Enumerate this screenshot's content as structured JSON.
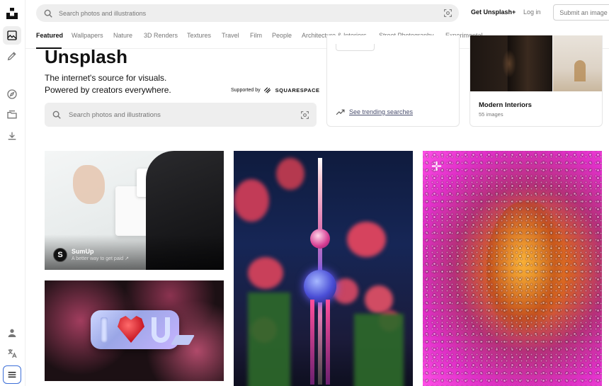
{
  "header": {
    "search_placeholder": "Search photos and illustrations",
    "get_plus": "Get Unsplash+",
    "login": "Log in",
    "submit": "Submit an image"
  },
  "tabs": [
    "Featured",
    "Wallpapers",
    "Nature",
    "3D Renders",
    "Textures",
    "Travel",
    "Film",
    "People",
    "Architecture & Interiors",
    "Street Photography",
    "Experimental"
  ],
  "active_tab": "Featured",
  "hero": {
    "title": "Unsplash",
    "subtitle_line1": "The internet's source for visuals.",
    "subtitle_line2": "Powered by creators everywhere.",
    "supported_by": "Supported by",
    "sponsor_brand": "SQUARESPACE",
    "search_placeholder": "Search photos and illustrations"
  },
  "trending": {
    "link": "See trending searches"
  },
  "collection": {
    "title": "Modern Interiors",
    "count": "55 images"
  },
  "sponsored_photo": {
    "name": "SumUp",
    "tagline": "A better way to get paid ↗"
  },
  "rail": [
    "unsplash-logo",
    "photos-icon",
    "illustrations-icon",
    "explore-icon",
    "collections-icon",
    "download-icon",
    "account-icon",
    "language-icon",
    "menu-icon"
  ]
}
